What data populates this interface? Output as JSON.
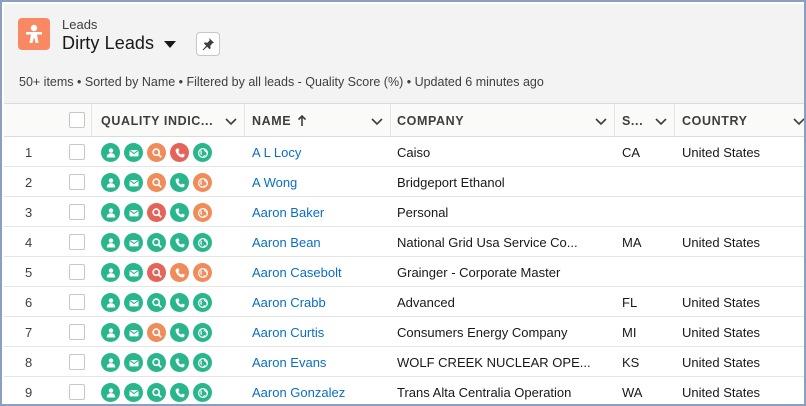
{
  "header": {
    "breadcrumb": "Leads",
    "title": "Dirty Leads",
    "summary": "50+ items • Sorted by Name • Filtered by all leads - Quality Score (%) • Updated 6 minutes ago",
    "app_icon": "lead-person-icon"
  },
  "columns": {
    "quality": "QUALITY INDIC...",
    "name": "NAME",
    "company": "COMPANY",
    "state": "S...",
    "country": "COUNTRY"
  },
  "colors": {
    "good": "#2ab68c",
    "warn": "#f08c5a",
    "bad": "#e4645c",
    "link": "#0b6ec5",
    "app": "#f88962"
  },
  "quality_icon_types": [
    "person",
    "email",
    "search",
    "phone",
    "globe"
  ],
  "rows": [
    {
      "num": "1",
      "name": "A L Locy",
      "company": "Caiso",
      "state": "CA",
      "country": "United States",
      "quality": [
        "good",
        "good",
        "warn",
        "bad",
        "good"
      ]
    },
    {
      "num": "2",
      "name": "A Wong",
      "company": "Bridgeport Ethanol",
      "state": "",
      "country": "",
      "quality": [
        "good",
        "good",
        "warn",
        "good",
        "warn"
      ]
    },
    {
      "num": "3",
      "name": "Aaron Baker",
      "company": "Personal",
      "state": "",
      "country": "",
      "quality": [
        "good",
        "good",
        "bad",
        "good",
        "warn"
      ]
    },
    {
      "num": "4",
      "name": "Aaron Bean",
      "company": "National Grid Usa Service Co...",
      "state": "MA",
      "country": "United States",
      "quality": [
        "good",
        "good",
        "good",
        "good",
        "good"
      ]
    },
    {
      "num": "5",
      "name": "Aaron Casebolt",
      "company": "Grainger - Corporate Master",
      "state": "",
      "country": "",
      "quality": [
        "good",
        "good",
        "bad",
        "warn",
        "warn"
      ]
    },
    {
      "num": "6",
      "name": "Aaron Crabb",
      "company": "Advanced",
      "state": "FL",
      "country": "United States",
      "quality": [
        "good",
        "good",
        "good",
        "good",
        "good"
      ]
    },
    {
      "num": "7",
      "name": "Aaron Curtis",
      "company": "Consumers Energy Company",
      "state": "MI",
      "country": "United States",
      "quality": [
        "good",
        "good",
        "warn",
        "good",
        "good"
      ]
    },
    {
      "num": "8",
      "name": "Aaron Evans",
      "company": "WOLF CREEK NUCLEAR OPE...",
      "state": "KS",
      "country": "United States",
      "quality": [
        "good",
        "good",
        "good",
        "good",
        "good"
      ]
    },
    {
      "num": "9",
      "name": "Aaron Gonzalez",
      "company": "Trans Alta Centralia Operation",
      "state": "WA",
      "country": "United States",
      "quality": [
        "good",
        "good",
        "good",
        "good",
        "good"
      ]
    }
  ]
}
